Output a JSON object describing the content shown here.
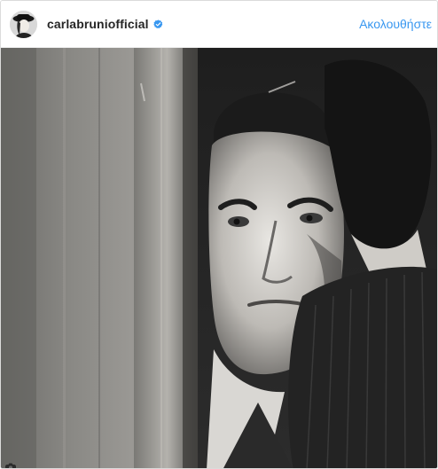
{
  "post": {
    "username": "carlabruniofficial",
    "follow_label": "Ακολουθήστε",
    "verified": true
  },
  "icons": {
    "avatar": "profile-picture",
    "verified": "verified-badge-icon",
    "corner": "camera-icon"
  },
  "colors": {
    "accent": "#3897f0",
    "text": "#262626",
    "border": "#dbdbdb"
  }
}
